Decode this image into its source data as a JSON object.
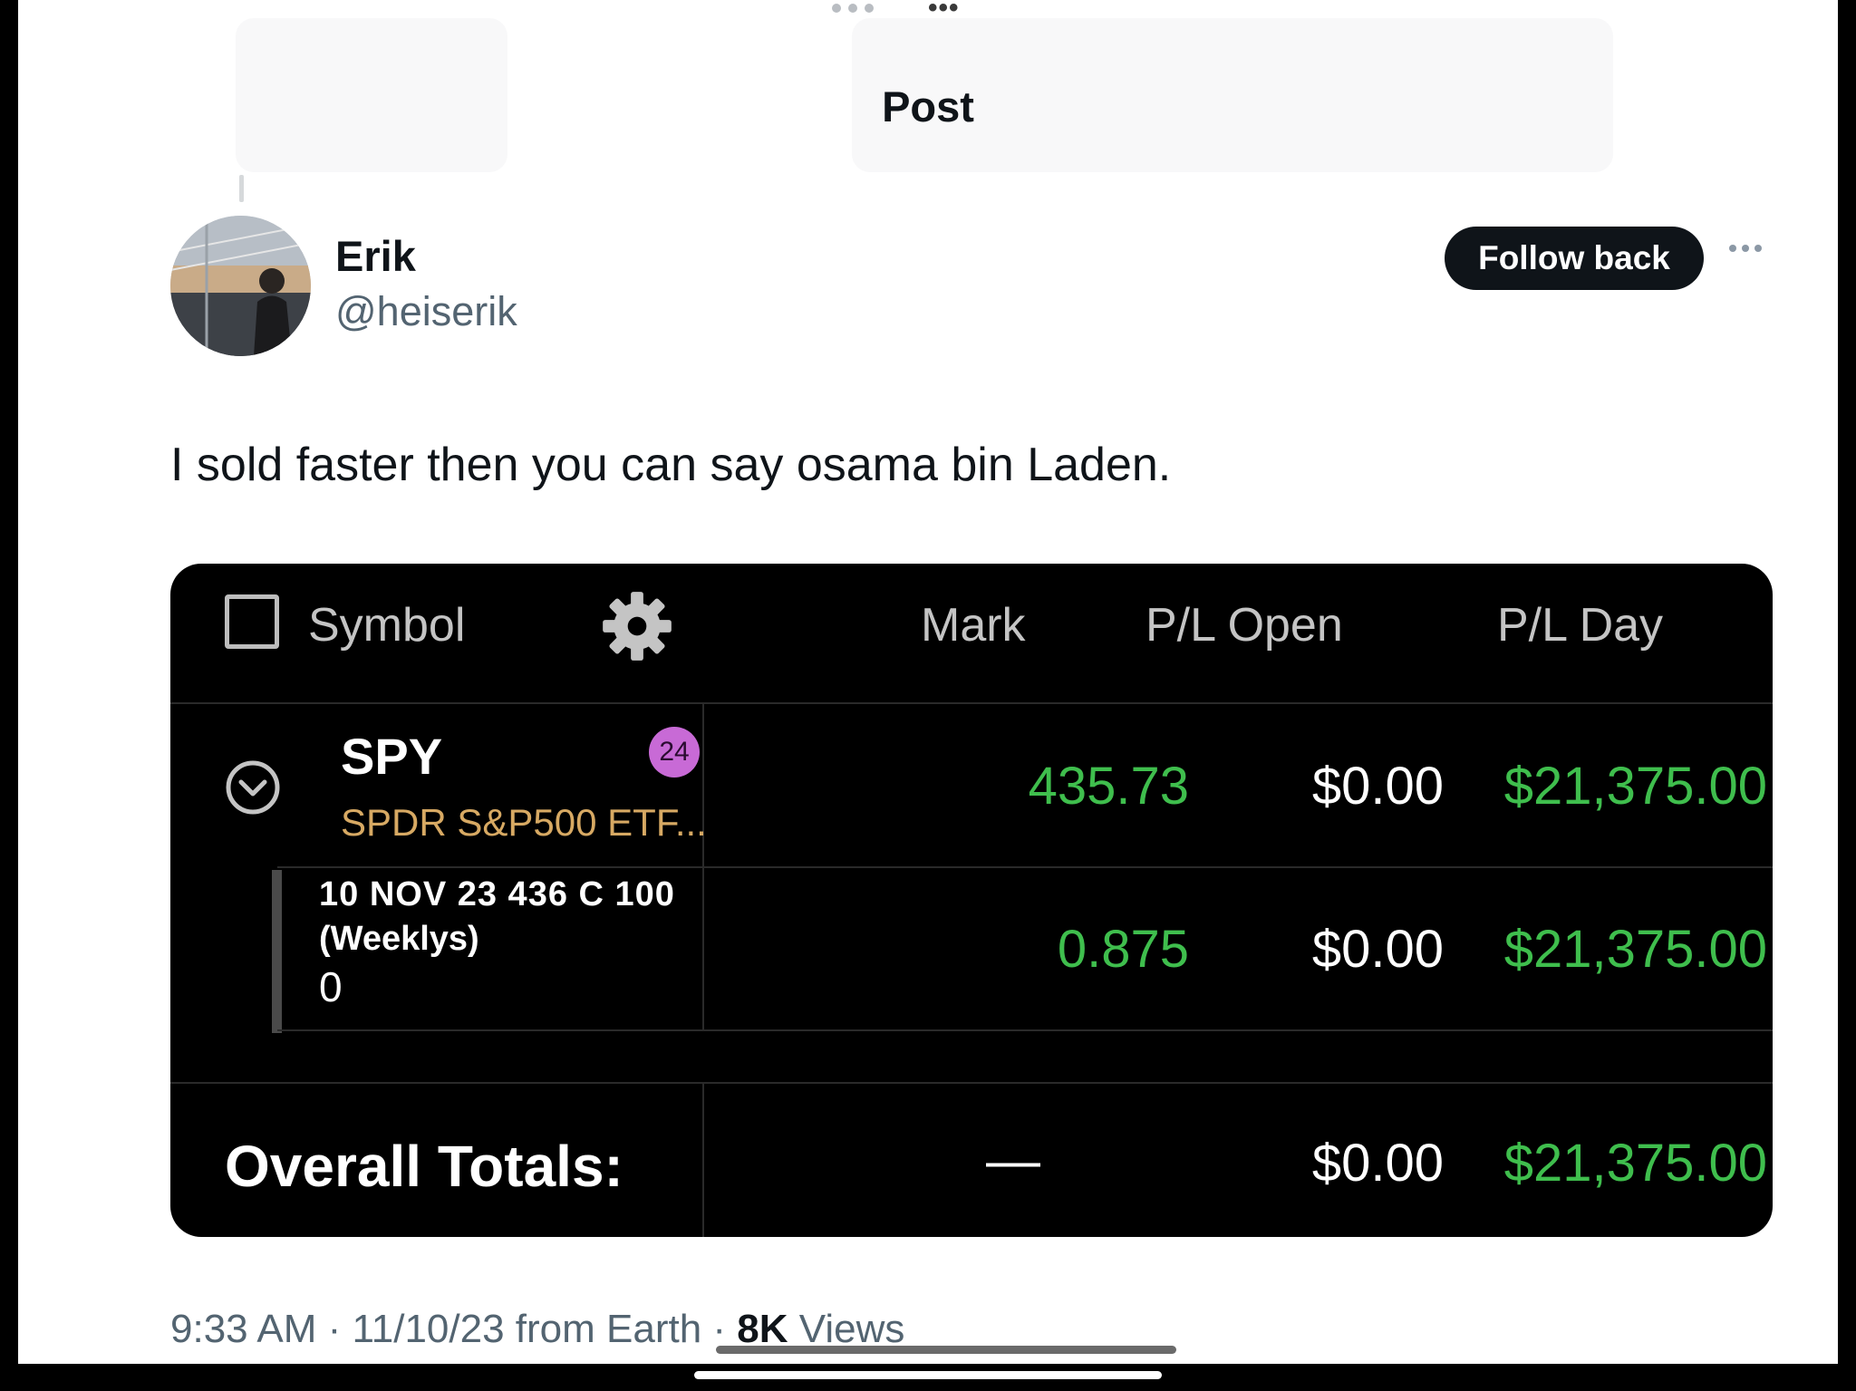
{
  "header": {
    "title": "Post"
  },
  "author": {
    "name": "Erik",
    "handle": "@heiserik",
    "follow_label": "Follow back"
  },
  "post": {
    "text": "I sold faster then you can say osama bin Laden."
  },
  "positions_table": {
    "columns": {
      "symbol": "Symbol",
      "mark": "Mark",
      "pl_open": "P/L Open",
      "pl_day": "P/L Day"
    },
    "position": {
      "symbol": "SPY",
      "badge": "24",
      "description": "SPDR S&P500 ETF...",
      "mark": "435.73",
      "pl_open": "$0.00",
      "pl_day": "$21,375.00"
    },
    "leg": {
      "contract": "10 NOV 23 436 C 100",
      "series": "(Weeklys)",
      "quantity": "0",
      "mark": "0.875",
      "pl_open": "$0.00",
      "pl_day": "$21,375.00"
    },
    "totals": {
      "label": "Overall Totals:",
      "mark": "—",
      "pl_open": "$0.00",
      "pl_day": "$21,375.00"
    },
    "colors": {
      "gain": "#3fbe4d",
      "description": "#d7a963",
      "badge": "#c86ad6"
    }
  },
  "meta": {
    "time": "9:33 AM",
    "date": "11/10/23",
    "source": "from Earth",
    "views_count": "8K",
    "views_label": "Views"
  }
}
